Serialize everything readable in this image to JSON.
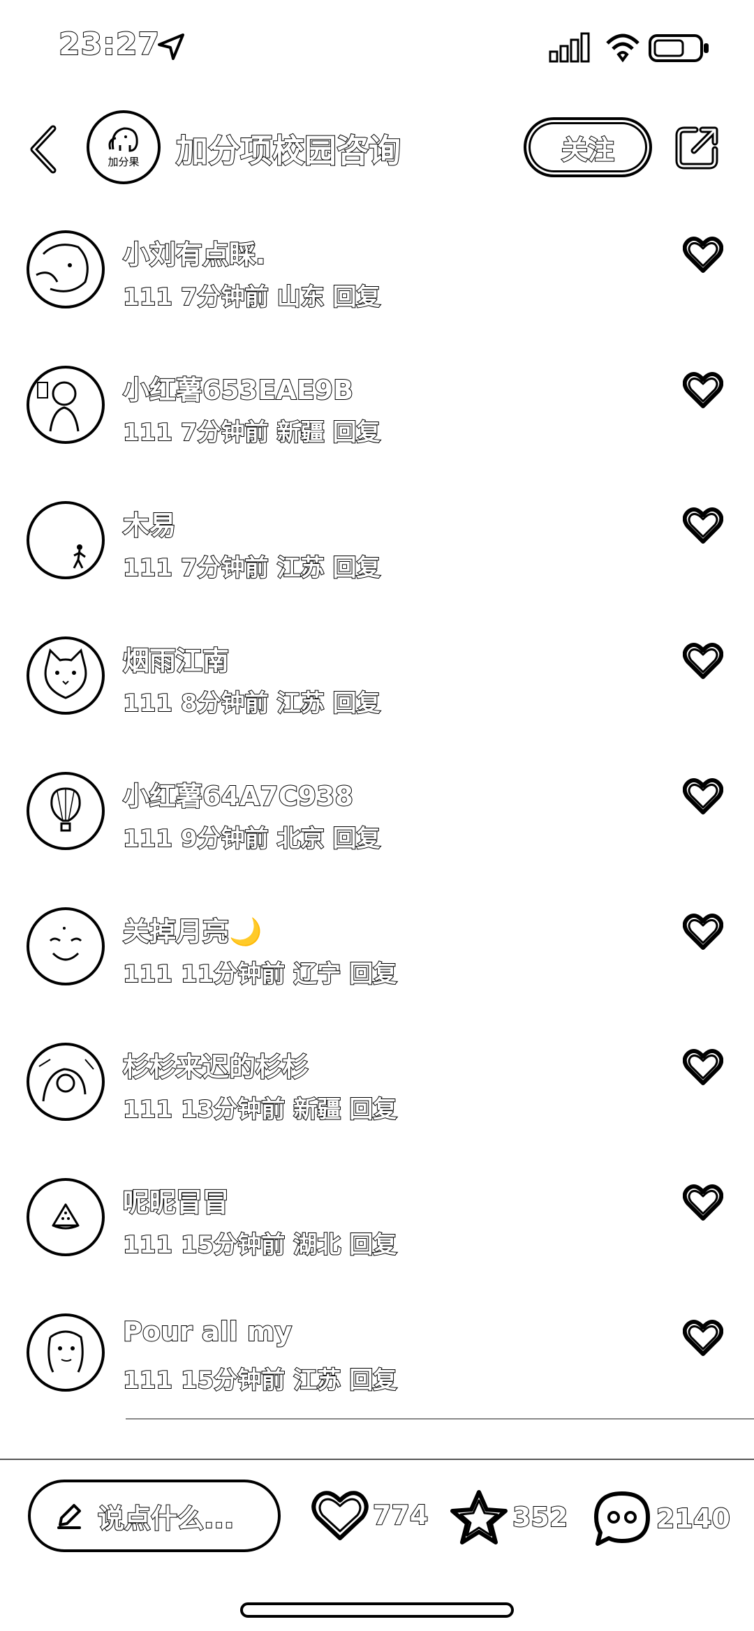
{
  "status_bar": {
    "time": "23:27"
  },
  "header": {
    "title": "加分项校园咨询",
    "follow_label": "关注",
    "logo_text": "加分果"
  },
  "comments": [
    {
      "name": "小刘有点睬.",
      "text": "111",
      "time": "7分钟前",
      "location": "山东",
      "reply": "回复",
      "avatar_icon": "girl-portrait"
    },
    {
      "name": "小红薯653EAE9B",
      "text": "111",
      "time": "7分钟前",
      "location": "新疆",
      "reply": "回复",
      "avatar_icon": "cartoon-figure"
    },
    {
      "name": "木易",
      "text": "111",
      "time": "7分钟前",
      "location": "江苏",
      "reply": "回复",
      "avatar_icon": "walking-person"
    },
    {
      "name": "烟雨江南",
      "text": "111",
      "time": "8分钟前",
      "location": "江苏",
      "reply": "回复",
      "avatar_icon": "cat"
    },
    {
      "name": "小红薯64A7C938",
      "text": "111",
      "time": "9分钟前",
      "location": "北京",
      "reply": "回复",
      "avatar_icon": "hot-air-balloon"
    },
    {
      "name": "关掉月亮🌙",
      "text": "111",
      "time": "11分钟前",
      "location": "辽宁",
      "reply": "回复",
      "avatar_icon": "smiling-face"
    },
    {
      "name": "杉杉来迟的杉杉",
      "text": "111",
      "time": "13分钟前",
      "location": "新疆",
      "reply": "回复",
      "avatar_icon": "girl-drawing"
    },
    {
      "name": "呢昵冒冒",
      "text": "111",
      "time": "15分钟前",
      "location": "湖北",
      "reply": "回复",
      "avatar_icon": "watermelon"
    },
    {
      "name": "Pour all my",
      "text": "111",
      "time": "15分钟前",
      "location": "江苏",
      "reply": "回复",
      "avatar_icon": "girl-photo"
    }
  ],
  "bottom_bar": {
    "input_placeholder": "说点什么...",
    "likes": "774",
    "stars": "352",
    "comments": "2140"
  }
}
